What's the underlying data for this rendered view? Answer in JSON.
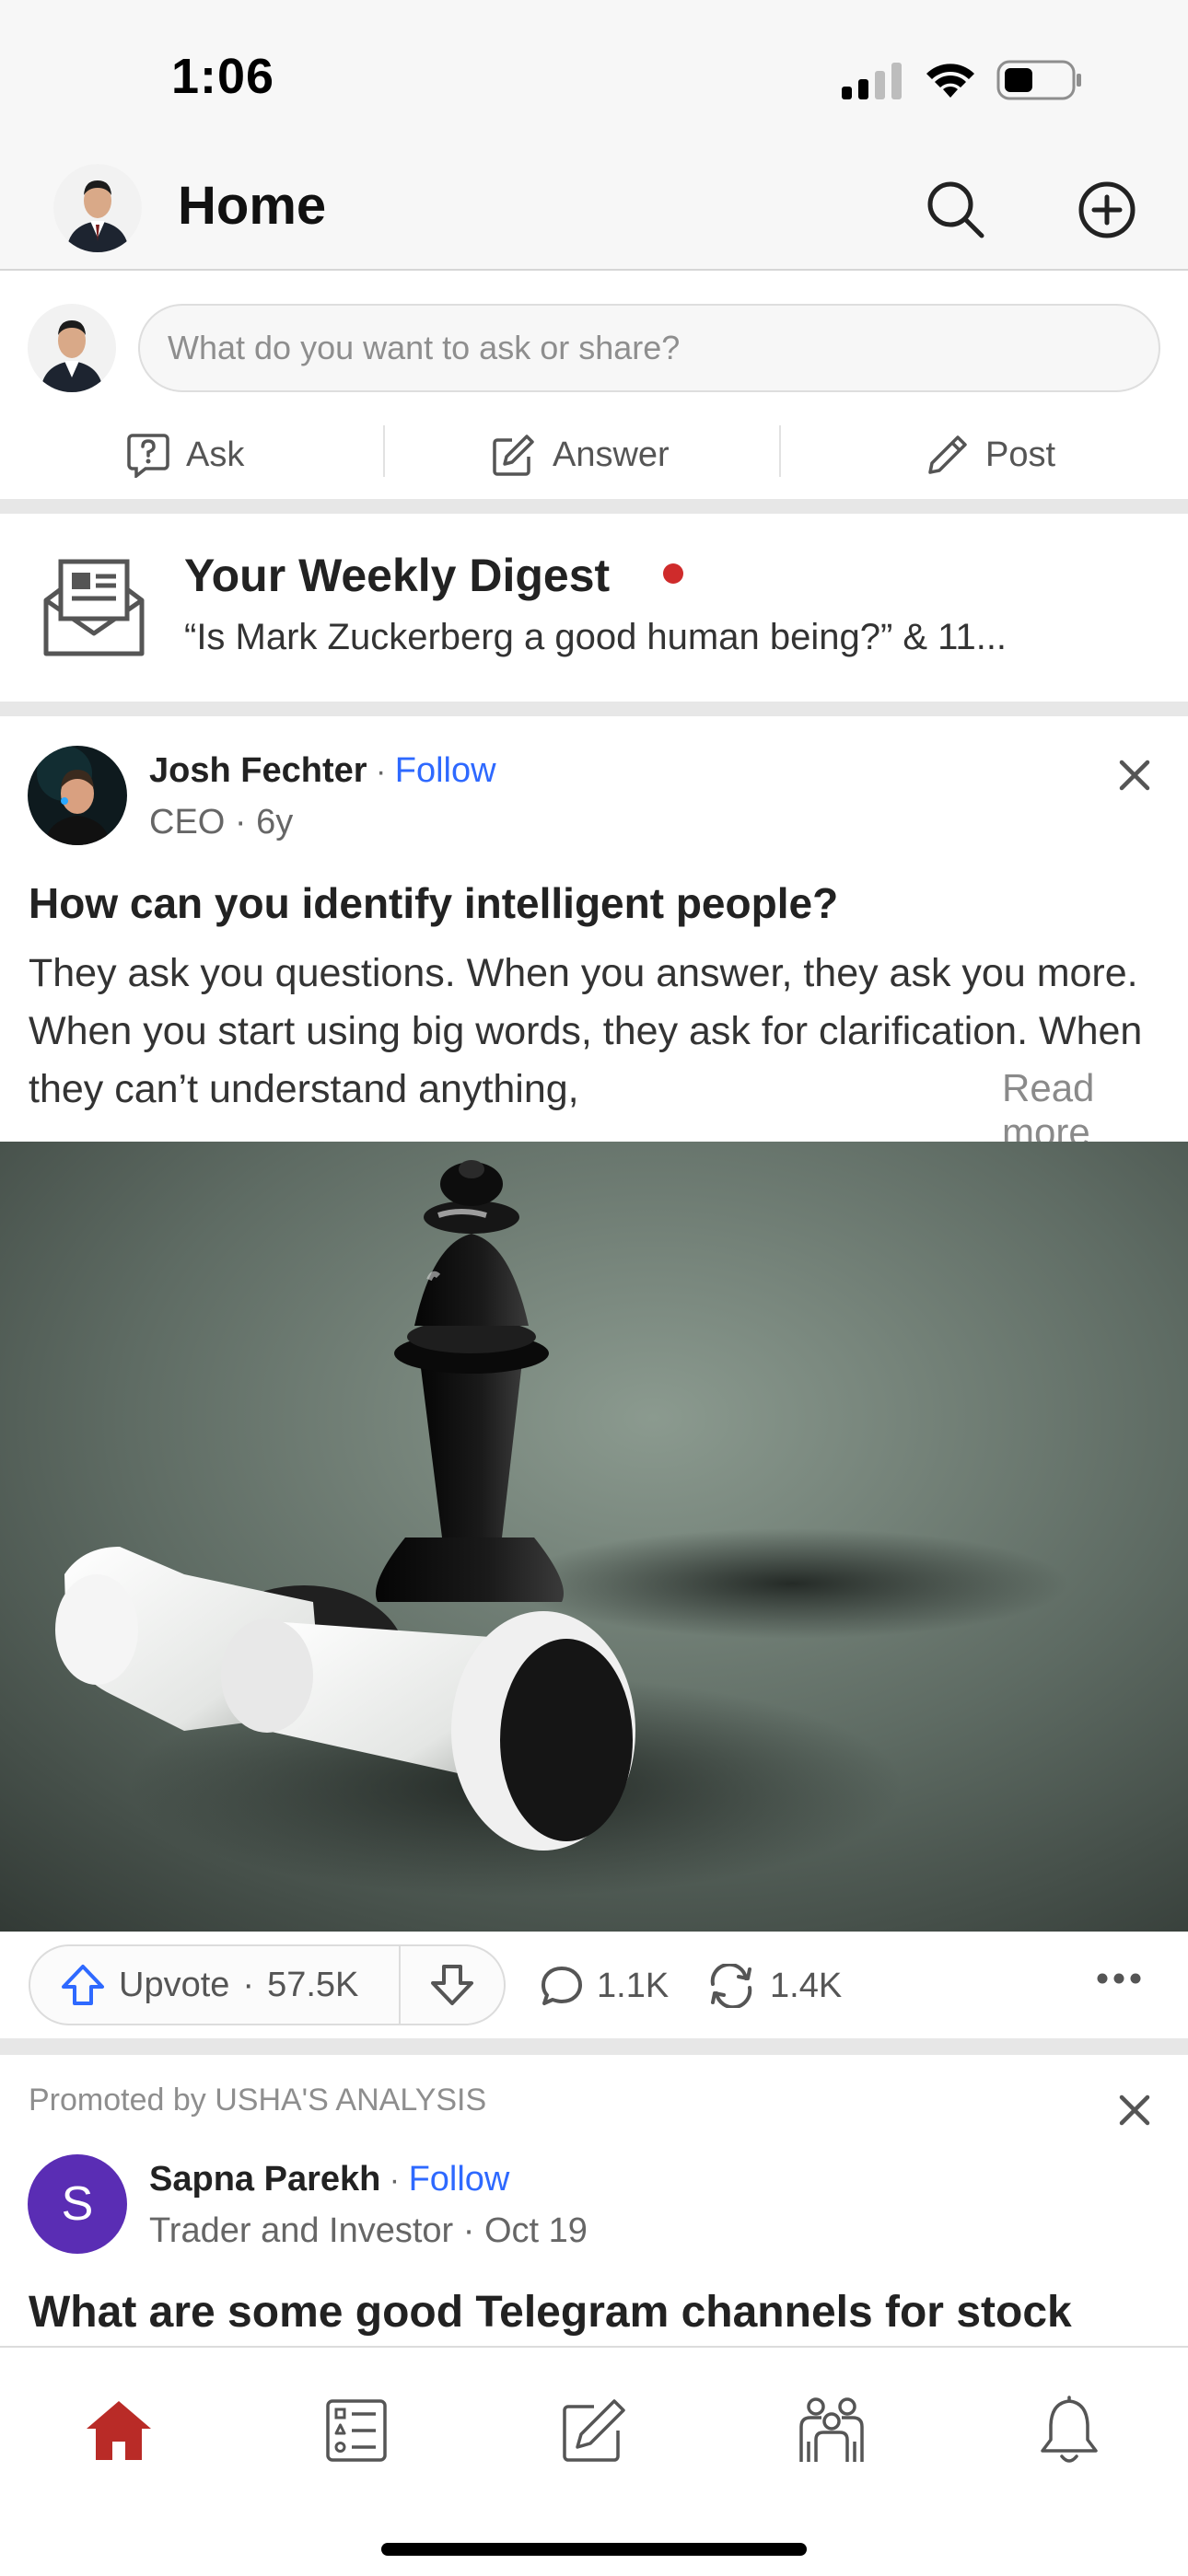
{
  "status_bar": {
    "time": "1:06"
  },
  "header": {
    "title": "Home"
  },
  "composer": {
    "placeholder": "What do you want to ask or share?",
    "actions": {
      "ask": "Ask",
      "answer": "Answer",
      "post": "Post"
    }
  },
  "digest": {
    "title": "Your Weekly Digest",
    "subtitle": "“Is Mark Zuckerberg a good human being?” & 11..."
  },
  "post": {
    "author": "Josh Fechter",
    "follow": "Follow",
    "credential": "CEO",
    "age": "6y",
    "title": "How can you identify intelligent people?",
    "body": "They ask you questions. When you answer, they ask you more. When you start using big words, they ask for clarification. When they can’t understand anything,",
    "read_more": "Read more",
    "upvote_label": "Upvote",
    "upvotes": "57.5K",
    "comments": "1.1K",
    "shares": "1.4K"
  },
  "promoted": {
    "label": "Promoted by USHA'S ANALYSIS",
    "avatar_letter": "S",
    "author": "Sapna Parekh",
    "follow": "Follow",
    "credential": "Trader and Investor",
    "date": "Oct 19",
    "title": "What are some good Telegram channels for stock"
  },
  "nav": {
    "items": [
      "home-icon",
      "following-icon",
      "answer-icon",
      "spaces-icon",
      "notifications-icon"
    ],
    "active": "home-icon"
  },
  "colors": {
    "brand": "#b92b27",
    "link": "#2e69ff",
    "notification_dot": "#cf2b2b",
    "promo_avatar": "#5a2db4"
  }
}
